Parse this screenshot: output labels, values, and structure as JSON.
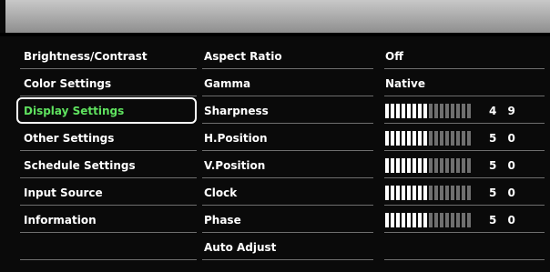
{
  "menu": {
    "items": [
      {
        "label": "Brightness/Contrast",
        "selected": false
      },
      {
        "label": "Color Settings",
        "selected": false
      },
      {
        "label": "Display Settings",
        "selected": true
      },
      {
        "label": "Other Settings",
        "selected": false
      },
      {
        "label": "Schedule Settings",
        "selected": false
      },
      {
        "label": "Input Source",
        "selected": false
      },
      {
        "label": "Information",
        "selected": false
      },
      {
        "label": "",
        "selected": false
      }
    ]
  },
  "display_settings": {
    "items": [
      {
        "label": "Aspect Ratio",
        "type": "option",
        "value": "Off"
      },
      {
        "label": "Gamma",
        "type": "option",
        "value": "Native"
      },
      {
        "label": "Sharpness",
        "type": "slider",
        "value": "4 9",
        "level": 0.49
      },
      {
        "label": "H.Position",
        "type": "slider",
        "value": "5 0",
        "level": 0.5
      },
      {
        "label": "V.Position",
        "type": "slider",
        "value": "5 0",
        "level": 0.5
      },
      {
        "label": "Clock",
        "type": "slider",
        "value": "5 0",
        "level": 0.5
      },
      {
        "label": "Phase",
        "type": "slider",
        "value": "5 0",
        "level": 0.5
      },
      {
        "label": "Auto Adjust",
        "type": "action",
        "value": ""
      }
    ]
  },
  "colors": {
    "selected_text": "#5fe25f",
    "header": "#b0b0b0",
    "bar_on": "#ffffff",
    "bar_off": "#6f6f6f"
  }
}
